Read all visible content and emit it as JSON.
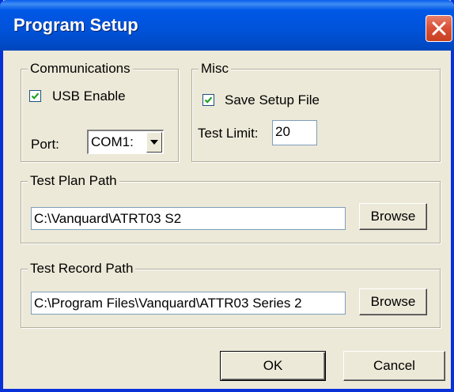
{
  "window": {
    "title": "Program Setup",
    "close_icon": "close-icon"
  },
  "communications": {
    "legend": "Communications",
    "usb_enable": {
      "label": "USB Enable",
      "checked": true
    },
    "port": {
      "label": "Port:",
      "value": "COM1:"
    }
  },
  "misc": {
    "legend": "Misc",
    "save_setup": {
      "label": "Save Setup File",
      "checked": true
    },
    "test_limit": {
      "label": "Test Limit:",
      "value": "20"
    }
  },
  "test_plan": {
    "legend": "Test Plan Path",
    "path": "C:\\Vanquard\\ATRT03 S2",
    "browse_label": "Browse"
  },
  "test_record": {
    "legend": "Test Record Path",
    "path": "C:\\Program Files\\Vanquard\\ATTR03 Series 2",
    "browse_label": "Browse"
  },
  "buttons": {
    "ok_label": "OK",
    "cancel_label": "Cancel"
  },
  "colors": {
    "titlebar": "#0054e3",
    "dialog_bg": "#ece9d8",
    "close_button": "#d9523a"
  }
}
